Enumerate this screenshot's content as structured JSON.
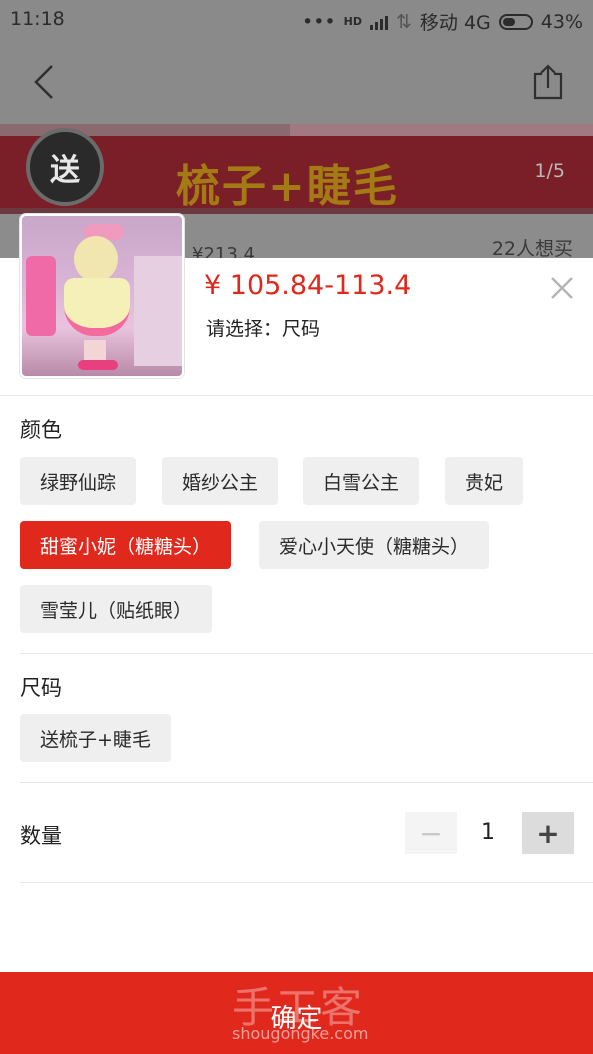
{
  "status_bar": {
    "time": "11:18",
    "hd_label": "HD",
    "carrier": "移动 4G",
    "battery": "43%"
  },
  "banner": {
    "badge": "送",
    "title": "梳子+睫毛",
    "pager": "1/5"
  },
  "info_strip": {
    "old_price": "¥213.4",
    "wants": "22人想买"
  },
  "sheet": {
    "price": "¥ 105.84-113.4",
    "select_hint": "请选择：尺码"
  },
  "color_section": {
    "title": "颜色",
    "options": [
      "绿野仙踪",
      "婚纱公主",
      "白雪公主",
      "贵妃",
      "甜蜜小妮（糖糖头）",
      "爱心小天使（糖糖头）",
      "雪莹儿（贴纸眼）"
    ],
    "selected_index": 4
  },
  "size_section": {
    "title": "尺码",
    "options": [
      "送梳子+睫毛"
    ]
  },
  "quantity": {
    "label": "数量",
    "value": "1",
    "minus": "−",
    "plus": "+"
  },
  "confirm_button": {
    "label": "确定"
  },
  "watermark": {
    "title": "手工客",
    "url": "shougongke.com"
  },
  "colors": {
    "accent": "#e0281c",
    "chip_bg": "#efefef"
  }
}
